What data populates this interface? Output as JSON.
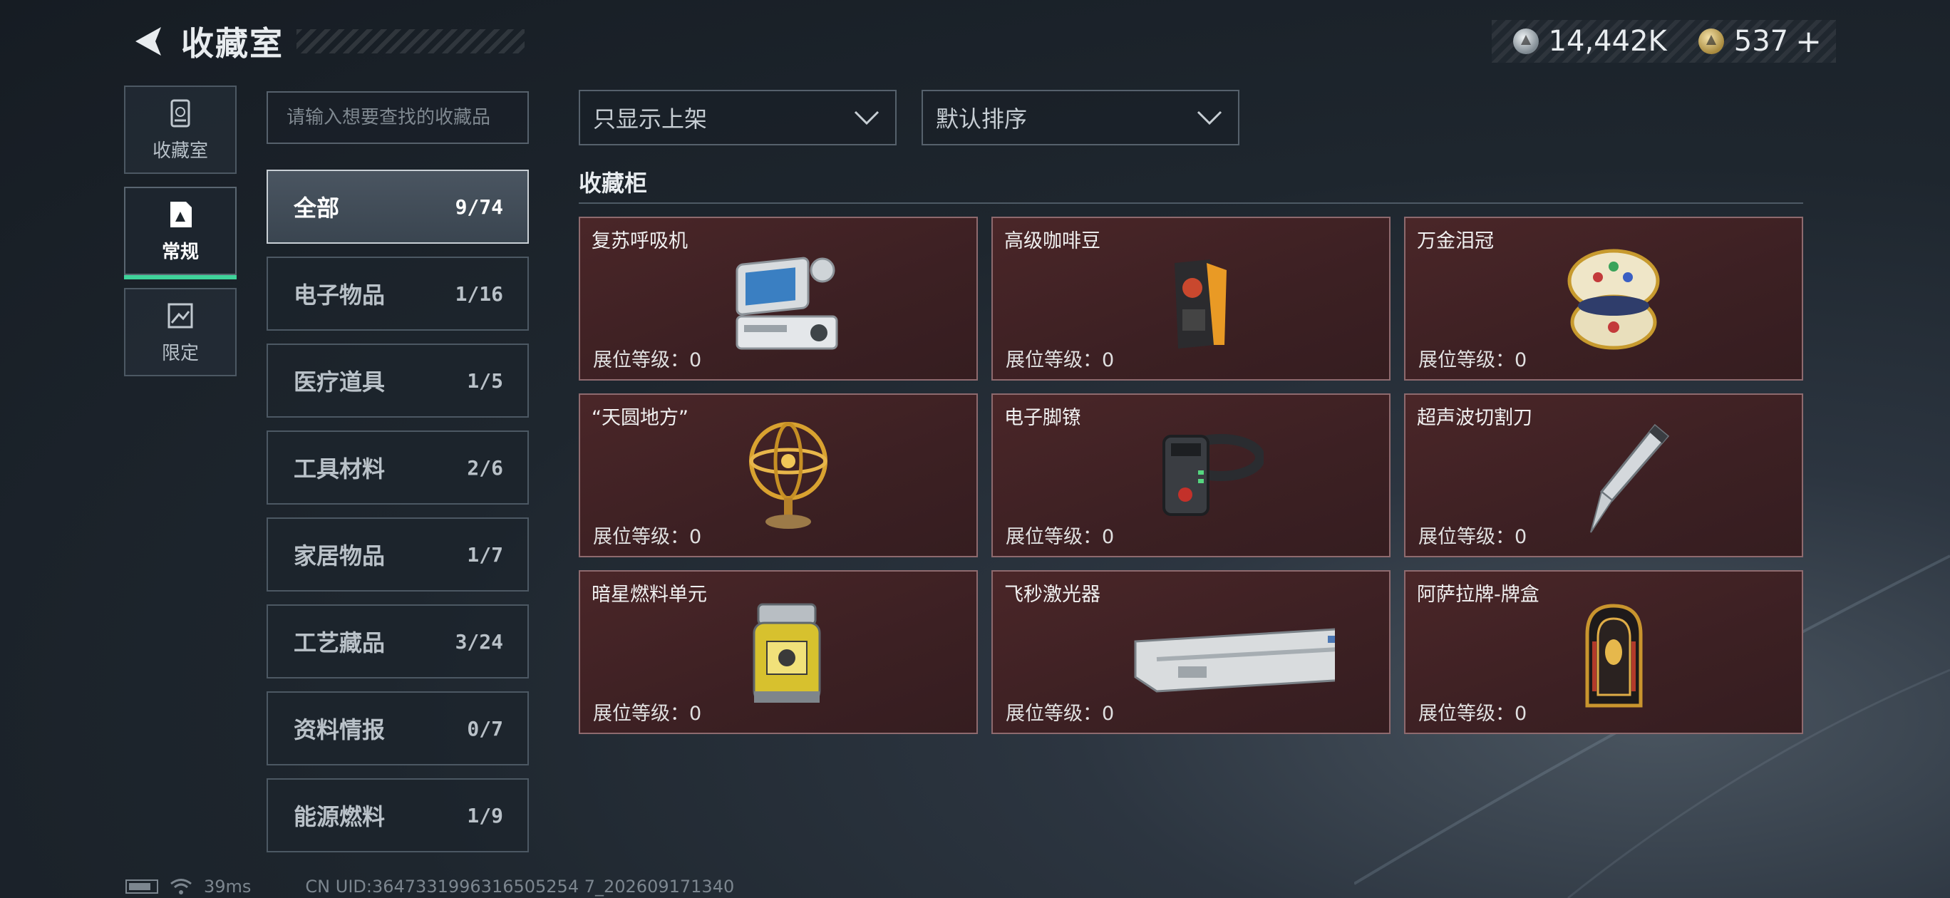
{
  "header": {
    "title": "收藏室"
  },
  "currency": {
    "silver": "14,442K",
    "gold": "537",
    "plus": "+"
  },
  "side_nav": [
    {
      "label": "收藏室",
      "icon": "bin-icon",
      "active": false
    },
    {
      "label": "常规",
      "icon": "document-icon",
      "active": true
    },
    {
      "label": "限定",
      "icon": "image-icon",
      "active": false
    }
  ],
  "search": {
    "placeholder": "请输入想要查找的收藏品"
  },
  "categories": [
    {
      "label": "全部",
      "count": "9/74",
      "active": true
    },
    {
      "label": "电子物品",
      "count": "1/16"
    },
    {
      "label": "医疗道具",
      "count": "1/5"
    },
    {
      "label": "工具材料",
      "count": "2/6"
    },
    {
      "label": "家居物品",
      "count": "1/7"
    },
    {
      "label": "工艺藏品",
      "count": "3/24"
    },
    {
      "label": "资料情报",
      "count": "0/7"
    },
    {
      "label": "能源燃料",
      "count": "1/9"
    }
  ],
  "filters": {
    "display": "只显示上架",
    "sort": "默认排序"
  },
  "cabinet": {
    "title": "收藏柜",
    "items": [
      {
        "name": "复苏呼吸机",
        "level": "展位等级：0",
        "icon": "ventilator-icon"
      },
      {
        "name": "高级咖啡豆",
        "level": "展位等级：0",
        "icon": "coffee-bag-icon"
      },
      {
        "name": "万金泪冠",
        "level": "展位等级：0",
        "icon": "jeweled-egg-icon"
      },
      {
        "name": "“天圆地方”",
        "level": "展位等级：0",
        "icon": "armillary-sphere-icon"
      },
      {
        "name": "电子脚镣",
        "level": "展位等级：0",
        "icon": "ankle-monitor-icon"
      },
      {
        "name": "超声波切割刀",
        "level": "展位等级：0",
        "icon": "ultrasonic-knife-icon"
      },
      {
        "name": "暗星燃料单元",
        "level": "展位等级：0",
        "icon": "fuel-canister-icon"
      },
      {
        "name": "飞秒激光器",
        "level": "展位等级：0",
        "icon": "laser-module-icon"
      },
      {
        "name": "阿萨拉牌-牌盒",
        "level": "展位等级：0",
        "icon": "card-box-icon"
      }
    ]
  },
  "status": {
    "ping": "39ms",
    "uid": "CN UID:3647331996316505254 7_202609171340"
  }
}
